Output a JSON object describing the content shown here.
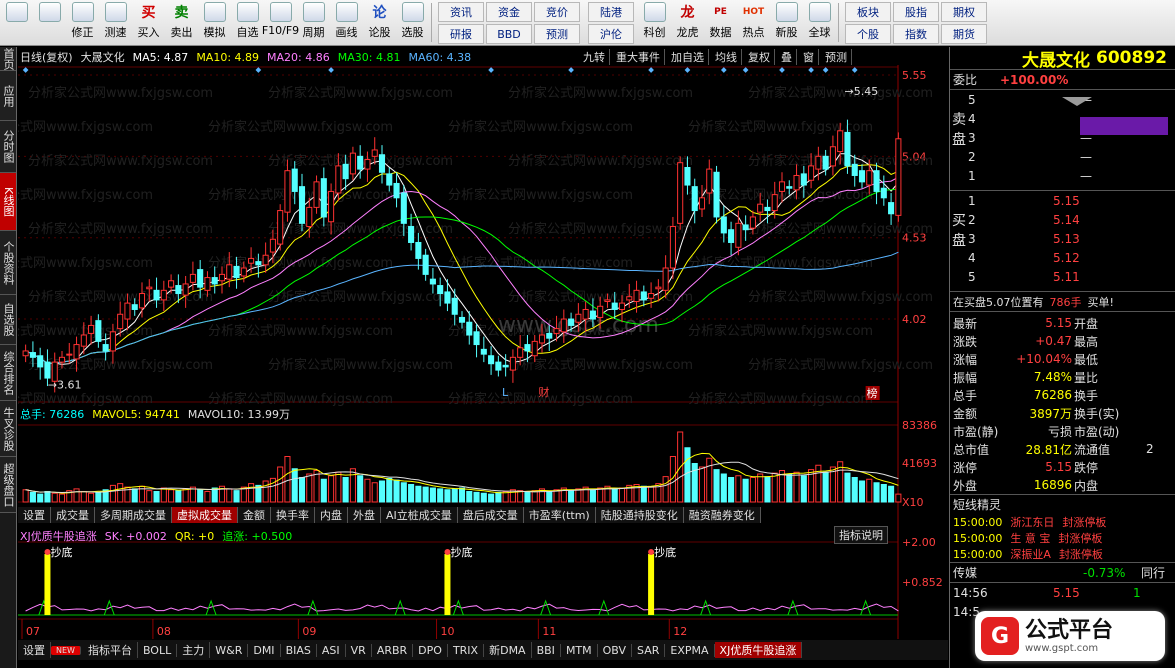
{
  "toolbar": {
    "left": [
      {
        "icon": "windows-icon",
        "label": ""
      },
      {
        "icon": "back-arrow-icon",
        "label": ""
      },
      {
        "icon": "updown-arrow-icon",
        "label": "修正"
      },
      {
        "icon": "clock-icon",
        "label": "测速"
      },
      {
        "icon": "buy-icon",
        "label": "买入",
        "glyph": "买"
      },
      {
        "icon": "sell-icon",
        "label": "卖出",
        "glyph": "卖"
      },
      {
        "icon": "hammer-icon",
        "label": "模拟"
      },
      {
        "icon": "home-icon",
        "label": "自选"
      },
      {
        "icon": "f10-icon",
        "label": "F10/F9"
      },
      {
        "icon": "period-icon",
        "label": "周期"
      },
      {
        "icon": "pen-icon",
        "label": "画线"
      },
      {
        "icon": "lun-icon",
        "label": "论股",
        "glyph": "论"
      },
      {
        "icon": "select-icon",
        "label": "选股"
      }
    ],
    "grid1": [
      "资讯",
      "资金",
      "竞价",
      "研报",
      "BBD",
      "预测"
    ],
    "grid2": [
      "陆港",
      "沪伦"
    ],
    "right": [
      {
        "icon": "science-icon",
        "label": "科创"
      },
      {
        "icon": "dragon-icon",
        "label": "龙虎",
        "glyph": "龙"
      },
      {
        "icon": "pe-icon",
        "label": "数据",
        "glyph": "PE"
      },
      {
        "icon": "hot-icon",
        "label": "热点",
        "glyph": "HOT"
      },
      {
        "icon": "new-stock-icon",
        "label": "新股"
      },
      {
        "icon": "globe-icon",
        "label": "全球"
      }
    ],
    "grid3": [
      "板块",
      "股指",
      "期权",
      "个股",
      "指数",
      "期货"
    ]
  },
  "left_tabs": [
    "首页",
    "应用",
    "分时图",
    "K线图",
    "个股资料",
    "自选股",
    "综合排名",
    "牛叉诊股",
    "超级盘口"
  ],
  "chart": {
    "period_label": "日线(复权)",
    "stock": "大晟文化",
    "ma": [
      {
        "label": "MA5: 4.87",
        "color": "#ffffff"
      },
      {
        "label": "MA10: 4.89",
        "color": "#ffff00"
      },
      {
        "label": "MA20: 4.86",
        "color": "#ff80ff"
      },
      {
        "label": "MA30: 4.81",
        "color": "#00ff00"
      },
      {
        "label": "MA60: 4.38",
        "color": "#5ab4ff"
      }
    ],
    "tools": [
      "九转",
      "重大事件",
      "加自选",
      "均线",
      "复权",
      "叠",
      "窗",
      "预测"
    ],
    "price_ticks": [
      "5.55",
      "5.04",
      "4.53",
      "4.02"
    ],
    "high_label": "5.45",
    "low_label": "3.61",
    "marker_l": "L",
    "marker_cai": "财",
    "marker_bang": "榜",
    "watermark_url": "www.gspt.com",
    "watermark_text": "分析家公式网www.fxjgsw.com",
    "volume_info": {
      "total": "总手: 76286",
      "mavol5": "MAVOL5: 94741",
      "mavol10": "MAVOL10: 13.99万"
    },
    "volume_ticks": [
      "83386",
      "41693",
      "X10"
    ],
    "indicator_tabs": [
      "设置",
      "成交量",
      "多周期成交量",
      "虚拟成交量",
      "金额",
      "换手率",
      "内盘",
      "外盘",
      "AI立桩成交量",
      "盘后成交量",
      "市盈率(ttm)",
      "陆股通持股变化",
      "融资融券变化"
    ],
    "indicator_active": 3,
    "indicator_info": {
      "name": "XJ优质牛股追涨",
      "sk": "SK: +0.002",
      "qr": "QR: +0",
      "zhuizhang": "追涨: +0.500"
    },
    "indicator_explain": "指标说明",
    "ind_ticks": [
      "2.00",
      "0.852"
    ],
    "signal_label": "抄底",
    "months": [
      "07",
      "08",
      "09",
      "10",
      "11",
      "12"
    ]
  },
  "bottom_tabs": [
    "设置",
    "指标平台",
    "BOLL",
    "主力",
    "W&R",
    "DMI",
    "BIAS",
    "ASI",
    "VR",
    "ARBR",
    "DPO",
    "TRIX",
    "新DMA",
    "BBI",
    "MTM",
    "OBV",
    "SAR",
    "EXPMA",
    "XJ优质牛股追涨"
  ],
  "bottom_new_badge": "NEW",
  "bottom_active": 18,
  "right": {
    "name": "大晟文化",
    "code": "600892",
    "weibi_label": "委比",
    "weibi_value": "+100.00%",
    "sell_label": "卖盘",
    "buy_label": "买盘",
    "sell": [
      {
        "lvl": "5",
        "p": "",
        "v": ""
      },
      {
        "lvl": "4",
        "p": "",
        "v": ""
      },
      {
        "lvl": "3",
        "p": "",
        "v": ""
      },
      {
        "lvl": "2",
        "p": "",
        "v": ""
      },
      {
        "lvl": "1",
        "p": "",
        "v": ""
      }
    ],
    "buy": [
      {
        "lvl": "1",
        "p": "5.15"
      },
      {
        "lvl": "2",
        "p": "5.14"
      },
      {
        "lvl": "3",
        "p": "5.13"
      },
      {
        "lvl": "4",
        "p": "5.12"
      },
      {
        "lvl": "5",
        "p": "5.11"
      }
    ],
    "pending_text": "在买盘5.07位置有",
    "pending_vol": "786手",
    "pending_tag": "买单!",
    "quote": [
      [
        "最新",
        "5.15",
        "开盘",
        ""
      ],
      [
        "涨跌",
        "+0.47",
        "最高",
        ""
      ],
      [
        "涨幅",
        "+10.04%",
        "最低",
        ""
      ],
      [
        "振幅",
        "7.48%",
        "量比",
        ""
      ],
      [
        "总手",
        "76286",
        "换手",
        ""
      ],
      [
        "金额",
        "3897万",
        "换手(实)",
        ""
      ],
      [
        "市盈(静)",
        "亏损",
        "市盈(动)",
        ""
      ],
      [
        "总市值",
        "28.81亿",
        "流通值",
        "2"
      ],
      [
        "涨停",
        "5.15",
        "跌停",
        ""
      ],
      [
        "外盘",
        "16896",
        "内盘",
        ""
      ]
    ],
    "news_title": "短线精灵",
    "news": [
      {
        "time": "15:00:00",
        "name": "浙江东日",
        "event": "封涨停板"
      },
      {
        "time": "15:00:00",
        "name": "生 意 宝",
        "event": "封涨停板"
      },
      {
        "time": "15:00:00",
        "name": "深振业A",
        "event": "封涨停板"
      }
    ],
    "media_label": "传媒",
    "media_change": "-0.73%",
    "tongxing": "同行",
    "ticks": [
      {
        "time": "14:56",
        "price": "5.15",
        "vol": "1"
      },
      {
        "time": "14:5",
        "price": "",
        "vol": ""
      }
    ]
  },
  "ad": {
    "brand": "公式平台",
    "url": "www.gspt.com",
    "glyph": "G"
  },
  "chart_data": {
    "type": "candlestick",
    "close": [
      3.82,
      3.78,
      3.72,
      3.65,
      3.75,
      3.78,
      3.8,
      3.86,
      3.92,
      3.98,
      3.88,
      3.82,
      3.94,
      4.05,
      4.12,
      4.08,
      4.18,
      4.22,
      4.14,
      4.2,
      4.26,
      4.18,
      4.24,
      4.3,
      4.22,
      4.28,
      4.24,
      4.3,
      4.36,
      4.28,
      4.34,
      4.4,
      4.36,
      4.42,
      4.52,
      4.7,
      4.95,
      4.82,
      4.62,
      4.72,
      4.88,
      4.66,
      4.82,
      4.98,
      4.9,
      5.06,
      4.96,
      5.02,
      5.08,
      4.94,
      4.86,
      4.78,
      4.62,
      4.5,
      4.4,
      4.3,
      4.24,
      4.18,
      4.12,
      4.05,
      4.0,
      3.92,
      3.86,
      3.8,
      3.74,
      3.7,
      3.72,
      3.78,
      3.84,
      3.82,
      3.88,
      3.92,
      3.9,
      3.96,
      4.02,
      3.98,
      4.05,
      4.08,
      4.02,
      4.1,
      4.14,
      4.08,
      4.12,
      4.16,
      4.2,
      4.14,
      4.18,
      4.22,
      4.34,
      4.6,
      5.0,
      4.86,
      4.7,
      4.78,
      4.96,
      4.66,
      4.56,
      4.5,
      4.62,
      4.58,
      4.66,
      4.74,
      4.7,
      4.8,
      4.88,
      4.84,
      4.92,
      4.86,
      4.98,
      5.04,
      4.96,
      5.1,
      5.2,
      4.98,
      4.92,
      4.88,
      4.95,
      4.82,
      4.78,
      4.68,
      5.15
    ],
    "volume": [
      14,
      11,
      9,
      12,
      10,
      9,
      13,
      15,
      12,
      10,
      11,
      14,
      19,
      21,
      17,
      15,
      18,
      13,
      12,
      16,
      14,
      13,
      15,
      17,
      14,
      12,
      16,
      18,
      15,
      13,
      17,
      21,
      19,
      24,
      27,
      40,
      52,
      38,
      28,
      32,
      36,
      26,
      30,
      34,
      28,
      38,
      30,
      26,
      22,
      24,
      27,
      25,
      22,
      20,
      18,
      17,
      16,
      15,
      14,
      15,
      16,
      12,
      11,
      10,
      9,
      11,
      12,
      14,
      13,
      11,
      13,
      15,
      12,
      14,
      16,
      13,
      15,
      17,
      14,
      16,
      18,
      15,
      16,
      19,
      20,
      18,
      17,
      21,
      29,
      52,
      80,
      62,
      44,
      40,
      50,
      37,
      32,
      28,
      30,
      26,
      28,
      32,
      29,
      33,
      36,
      32,
      34,
      30,
      37,
      42,
      34,
      40,
      46,
      33,
      28,
      24,
      26,
      22,
      20,
      18,
      9
    ],
    "price_range": [
      3.5,
      5.6
    ],
    "volume_max": 88000,
    "axis_labels": [
      "5.55",
      "5.04",
      "4.53",
      "4.02"
    ],
    "months": [
      "07",
      "08",
      "09",
      "10",
      "11",
      "12"
    ]
  }
}
